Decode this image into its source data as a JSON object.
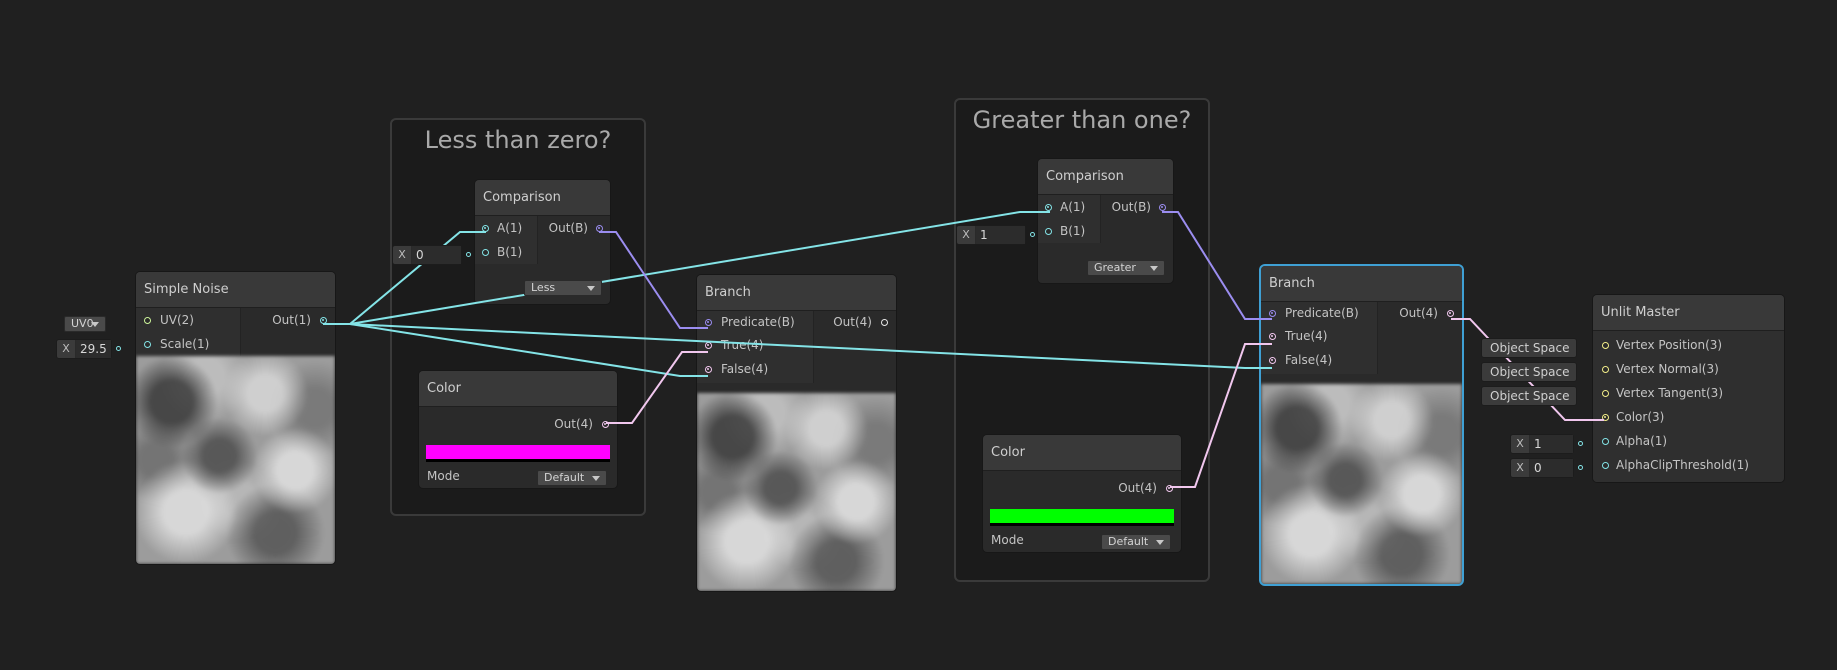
{
  "groups": {
    "less_than_zero": {
      "title": "Less than zero?"
    },
    "greater_than_one": {
      "title": "Greater than one?"
    }
  },
  "simple_noise": {
    "title": "Simple Noise",
    "inputs": [
      "UV(2)",
      "Scale(1)"
    ],
    "output": "Out(1)",
    "uv_dropdown": "UV0",
    "scale_field": {
      "label": "X",
      "value": "29.5"
    }
  },
  "comparison_1": {
    "title": "Comparison",
    "inputs": [
      "A(1)",
      "B(1)"
    ],
    "output": "Out(B)",
    "mode": "Less",
    "b_field": {
      "label": "X",
      "value": "0"
    }
  },
  "color_1": {
    "title": "Color",
    "output": "Out(4)",
    "swatch": "#ff00ff",
    "mode_label": "Mode",
    "mode_value": "Default"
  },
  "branch_1": {
    "title": "Branch",
    "inputs": [
      "Predicate(B)",
      "True(4)",
      "False(4)"
    ],
    "output": "Out(4)"
  },
  "comparison_2": {
    "title": "Comparison",
    "inputs": [
      "A(1)",
      "B(1)"
    ],
    "output": "Out(B)",
    "mode": "Greater",
    "b_field": {
      "label": "X",
      "value": "1"
    }
  },
  "color_2": {
    "title": "Color",
    "output": "Out(4)",
    "swatch": "#00ff00",
    "mode_label": "Mode",
    "mode_value": "Default"
  },
  "branch_2": {
    "title": "Branch",
    "inputs": [
      "Predicate(B)",
      "True(4)",
      "False(4)"
    ],
    "output": "Out(4)"
  },
  "unlit_master": {
    "title": "Unlit Master",
    "inputs": [
      "Vertex Position(3)",
      "Vertex Normal(3)",
      "Vertex Tangent(3)",
      "Color(3)",
      "Alpha(1)",
      "AlphaClipThreshold(1)"
    ],
    "space_tags": [
      "Object Space",
      "Object Space",
      "Object Space"
    ],
    "alpha_field": {
      "label": "X",
      "value": "1"
    },
    "clip_field": {
      "label": "X",
      "value": "0"
    }
  },
  "colors": {
    "background": "#202020",
    "float_wire": "#84e4e7",
    "bool_wire": "#9b8df0",
    "vector4_wire": "#f1c7ee",
    "selection": "#3fa0d4"
  }
}
